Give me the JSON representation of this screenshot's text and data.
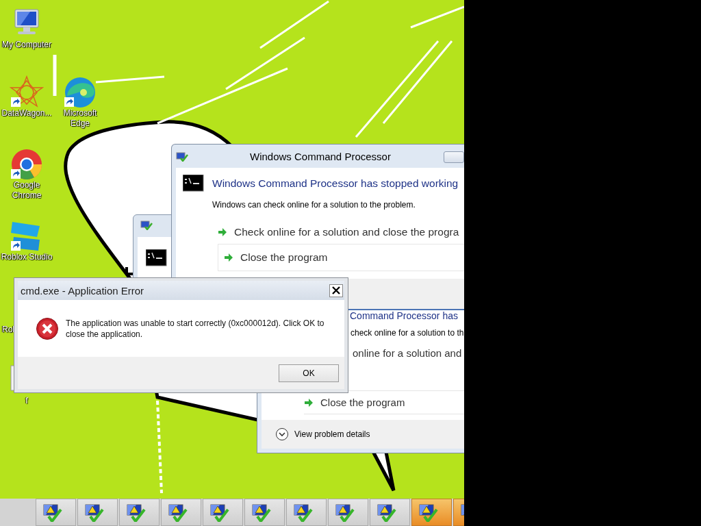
{
  "desktop_icons": [
    {
      "label": "My Computer",
      "kind": "computer",
      "shortcut": false
    },
    {
      "label": "DataWagon...",
      "kind": "star",
      "shortcut": true
    },
    {
      "label": "Microsoft Edge",
      "kind": "swirl",
      "shortcut": true
    },
    {
      "label": "Google Chrome",
      "kind": "chrome",
      "shortcut": true
    },
    {
      "label": "Roblox Studio",
      "kind": "squares",
      "shortcut": true
    },
    {
      "label": "Rol",
      "kind": "covered"
    },
    {
      "label": "f",
      "kind": "file"
    }
  ],
  "background_window": {
    "kind": "cmd"
  },
  "problem_dialog": {
    "title": "Windows Command Processor",
    "heading": "Windows Command Processor has stopped working",
    "message": "Windows can check online for a solution to the problem.",
    "options": [
      "Check online for a solution and close the progra",
      "Close the program"
    ]
  },
  "problem_dialog_behind": {
    "heading": "Command Processor has",
    "message": "check online for a solution to th",
    "options": [
      "online for a solution and",
      "Close the program"
    ],
    "details": "View problem details"
  },
  "error_dialog": {
    "title": "cmd.exe - Application Error",
    "message": "The application was unable to start correctly (0xc000012d). Click OK to close the application.",
    "button": "OK"
  },
  "taskbar": {
    "buttons": [
      {
        "highlighted": false
      },
      {
        "highlighted": false
      },
      {
        "highlighted": false
      },
      {
        "highlighted": false
      },
      {
        "highlighted": false
      },
      {
        "highlighted": false
      },
      {
        "highlighted": false
      },
      {
        "highlighted": false
      },
      {
        "highlighted": false
      },
      {
        "highlighted": true
      },
      {
        "highlighted": true
      }
    ]
  }
}
